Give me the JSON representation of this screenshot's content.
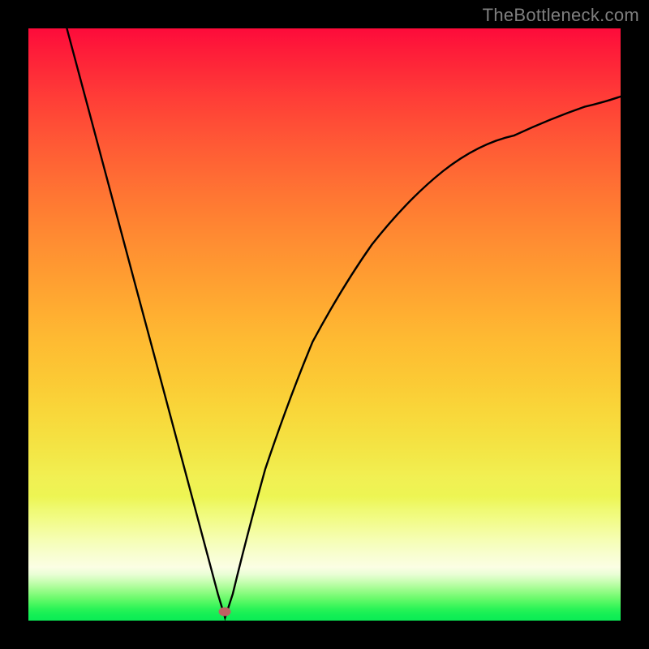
{
  "watermark": "TheBottleneck.com",
  "colors": {
    "frame": "#000000",
    "curve": "#000000",
    "marker": "#bf6163",
    "watermark": "#7f7f7f"
  },
  "chart_data": {
    "type": "line",
    "title": "",
    "xlabel": "",
    "ylabel": "",
    "xlim": [
      0,
      100
    ],
    "ylim": [
      0,
      100
    ],
    "grid": false,
    "legend": false,
    "background": "red-to-green vertical gradient (red top, green bottom via orange/yellow)",
    "marker": {
      "x": 33.2,
      "y": 1.5
    },
    "series": [
      {
        "name": "bottleneck-curve",
        "x": [
          6.5,
          10,
          14,
          18,
          22,
          26,
          30,
          32,
          33.2,
          34.5,
          37,
          40,
          44,
          48,
          53,
          58,
          64,
          70,
          76,
          82,
          88,
          94,
          100
        ],
        "y": [
          100,
          86.9,
          71.9,
          56.9,
          42.0,
          27.0,
          12.0,
          4.5,
          0.5,
          4.5,
          14.8,
          25.6,
          37.5,
          47.1,
          56.4,
          63.5,
          69.8,
          74.5,
          78.0,
          80.7,
          82.8,
          84.4,
          85.6
        ]
      }
    ]
  }
}
